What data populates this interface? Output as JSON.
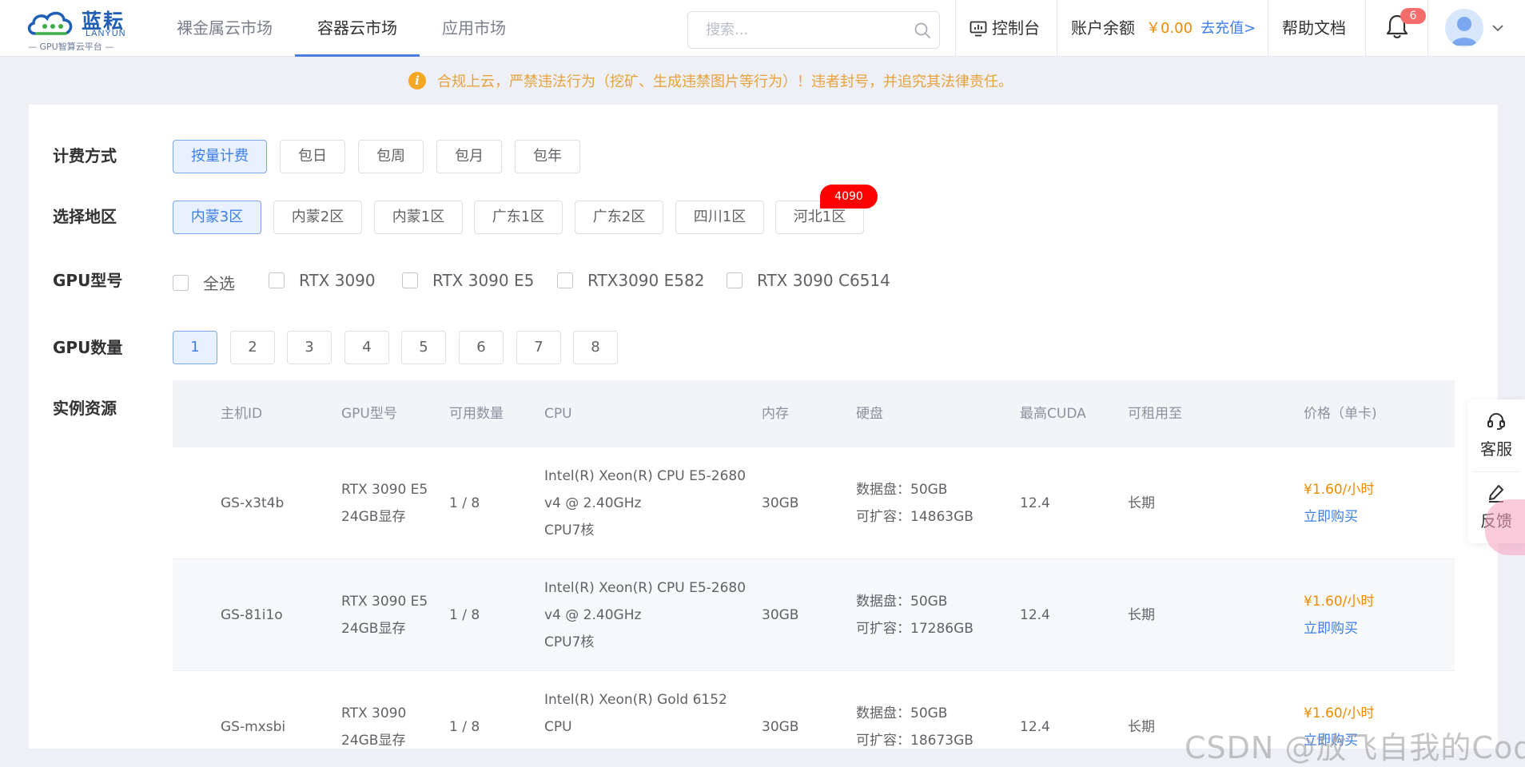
{
  "brand": {
    "name_cn": "蓝耘",
    "name_en": "LANYUN",
    "sub": "GPU智算云平台"
  },
  "nav": [
    {
      "label": "裸金属云市场"
    },
    {
      "label": "容器云市场"
    },
    {
      "label": "应用市场"
    }
  ],
  "search": {
    "placeholder": "搜索..."
  },
  "header": {
    "console": "控制台",
    "balance_label": "账户余额",
    "balance_amount": "￥0.00",
    "recharge": "去充值>",
    "help": "帮助文档",
    "notifications": "6"
  },
  "notice": "合规上云，严禁违法行为（挖矿、生成违禁图片等行为）！违者封号，并追究其法律责任。",
  "filters": {
    "billing_label": "计费方式",
    "billing": [
      "按量计费",
      "包日",
      "包周",
      "包月",
      "包年"
    ],
    "region_label": "选择地区",
    "regions": [
      "内蒙3区",
      "内蒙2区",
      "内蒙1区",
      "广东1区",
      "广东2区",
      "四川1区",
      "河北1区"
    ],
    "region_badge": "4090",
    "gpu_model_label": "GPU型号",
    "gpu_models": [
      "全选",
      "RTX 3090",
      "RTX 3090 E5",
      "RTX3090 E582",
      "RTX 3090 C6514"
    ],
    "gpu_count_label": "GPU数量",
    "gpu_counts": [
      "1",
      "2",
      "3",
      "4",
      "5",
      "6",
      "7",
      "8"
    ],
    "instances_label": "实例资源"
  },
  "table": {
    "headers": [
      "主机ID",
      "GPU型号",
      "可用数量",
      "CPU",
      "内存",
      "硬盘",
      "最高CUDA",
      "可租用至",
      "价格（单卡)"
    ],
    "rows": [
      {
        "id": "GS-x3t4b",
        "gpu1": "RTX 3090 E5",
        "gpu2": "24GB显存",
        "avail": "1 / 8",
        "cpu1": "Intel(R) Xeon(R) CPU E5-2680",
        "cpu2": "v4 @ 2.40GHz",
        "cpu3": "CPU7核",
        "mem": "30GB",
        "disk1": "数据盘：50GB",
        "disk2": "可扩容：14863GB",
        "cuda": "12.4",
        "until": "长期",
        "price": "¥1.60/小时",
        "buy": "立即购买"
      },
      {
        "id": "GS-81i1o",
        "gpu1": "RTX 3090 E5",
        "gpu2": "24GB显存",
        "avail": "1 / 8",
        "cpu1": "Intel(R) Xeon(R) CPU E5-2680",
        "cpu2": "v4 @ 2.40GHz",
        "cpu3": "CPU7核",
        "mem": "30GB",
        "disk1": "数据盘：50GB",
        "disk2": "可扩容：17286GB",
        "cuda": "12.4",
        "until": "长期",
        "price": "¥1.60/小时",
        "buy": "立即购买"
      },
      {
        "id": "GS-mxsbi",
        "gpu1": "RTX 3090",
        "gpu2": "24GB显存",
        "avail": "1 / 8",
        "cpu1": "Intel(R) Xeon(R) Gold 6152",
        "cpu2": "CPU",
        "cpu3": "",
        "mem": "30GB",
        "disk1": "数据盘：50GB",
        "disk2": "可扩容：18673GB",
        "cuda": "12.4",
        "until": "长期",
        "price": "¥1.60/小时",
        "buy": "立即购买"
      }
    ]
  },
  "side": {
    "service": "客服",
    "feedback": "反馈"
  },
  "watermark": "CSDN @放飞自我的Coder",
  "colors": {
    "accent": "#3d7ee8",
    "price": "#f08a00",
    "warning": "#e6a23c",
    "badge": "#f56c6c",
    "hot": "#ff0000"
  }
}
